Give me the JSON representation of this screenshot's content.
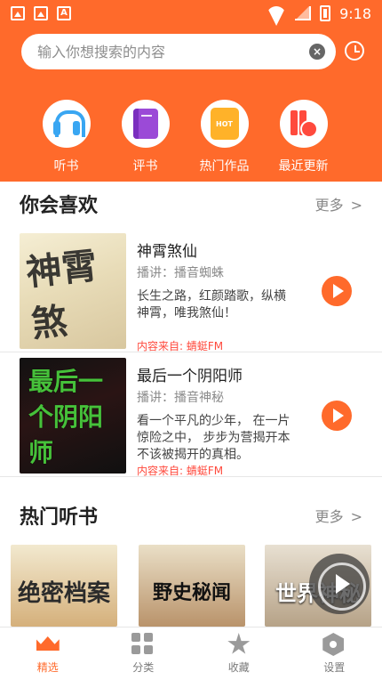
{
  "status_bar": {
    "time": "9:18"
  },
  "search": {
    "placeholder": "输入你想搜索的内容"
  },
  "quick_links": [
    {
      "label": "听书",
      "icon": "headphones-icon"
    },
    {
      "label": "评书",
      "icon": "book-icon"
    },
    {
      "label": "热门作品",
      "icon": "hot-icon",
      "icon_text": "HOT"
    },
    {
      "label": "最近更新",
      "icon": "recent-update-icon"
    }
  ],
  "recommend": {
    "title": "你会喜欢",
    "more": "更多",
    "more_arrow": ">",
    "items": [
      {
        "cover_text": "神霄煞",
        "title": "神霄煞仙",
        "narrator": "播讲：播音蜘蛛",
        "description": "长生之路，红颜踏歌，纵横神霄，唯我煞仙！",
        "source": "内容来自: 蜻蜓FM"
      },
      {
        "cover_text": "最后一个阴阳师",
        "title": "最后一个阴阳师",
        "narrator": "播讲：播音神秘",
        "description": "看一个平凡的少年， 在一片惊险之中， 步步为营揭开本不该被揭开的真相。",
        "source": "内容来自: 蜻蜓FM"
      }
    ]
  },
  "hot": {
    "title": "热门听书",
    "more": "更多",
    "more_arrow": ">",
    "cards": [
      {
        "cover_text": "绝密档案"
      },
      {
        "cover_text": "野史秘闻"
      },
      {
        "cover_text": "世界神秘"
      }
    ]
  },
  "bottom_nav": [
    {
      "label": "精选",
      "active": true
    },
    {
      "label": "分类",
      "active": false
    },
    {
      "label": "收藏",
      "active": false
    },
    {
      "label": "设置",
      "active": false
    }
  ],
  "colors": {
    "accent": "#ff6a2b",
    "source_red": "#ff4a3d"
  }
}
